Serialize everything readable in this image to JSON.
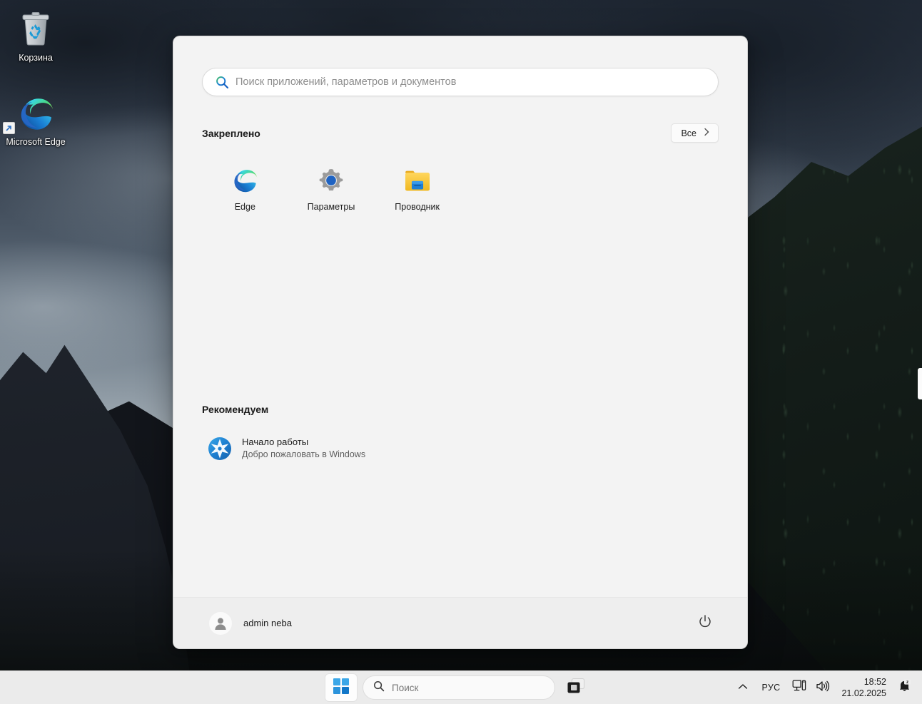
{
  "desktop": {
    "icons": [
      {
        "name": "recycle-bin",
        "label": "Корзина",
        "icon": "recycle-bin-icon"
      },
      {
        "name": "microsoft-edge",
        "label": "Microsoft Edge",
        "icon": "edge-icon",
        "shortcut": true
      }
    ]
  },
  "start_menu": {
    "search": {
      "placeholder": "Поиск приложений, параметров и документов",
      "value": "",
      "icon": "search-icon"
    },
    "pinned": {
      "title": "Закреплено",
      "all_apps_label": "Все",
      "all_apps_icon": "chevron-right-icon",
      "apps": [
        {
          "label": "Edge",
          "icon": "edge-icon"
        },
        {
          "label": "Параметры",
          "icon": "settings-gear-icon"
        },
        {
          "label": "Проводник",
          "icon": "file-explorer-folder-icon"
        }
      ]
    },
    "recommended": {
      "title": "Рекомендуем",
      "items": [
        {
          "title": "Начало работы",
          "subtitle": "Добро пожаловать в Windows",
          "icon": "get-started-star-icon"
        }
      ]
    },
    "footer": {
      "user_name": "admin neba",
      "avatar_icon": "user-avatar-icon",
      "power_icon": "power-icon"
    }
  },
  "taskbar": {
    "start_label": "Пуск",
    "start_icon": "windows-logo-icon",
    "search": {
      "placeholder": "Поиск",
      "value": "",
      "icon": "search-icon"
    },
    "task_view_icon": "task-view-icon",
    "tray": {
      "chevron_icon": "chevron-up-icon",
      "language": "РУС",
      "network_icon": "network-monitor-icon",
      "volume_icon": "speaker-icon",
      "time": "18:52",
      "date": "21.02.2025",
      "notification_icon": "bell-dnd-icon"
    }
  },
  "colors": {
    "accent": "#0078d4",
    "menu_bg": "#f3f3f3",
    "taskbar_bg": "#ebebeb",
    "text_primary": "#1a1a1a",
    "text_secondary": "#5e5e5e"
  }
}
